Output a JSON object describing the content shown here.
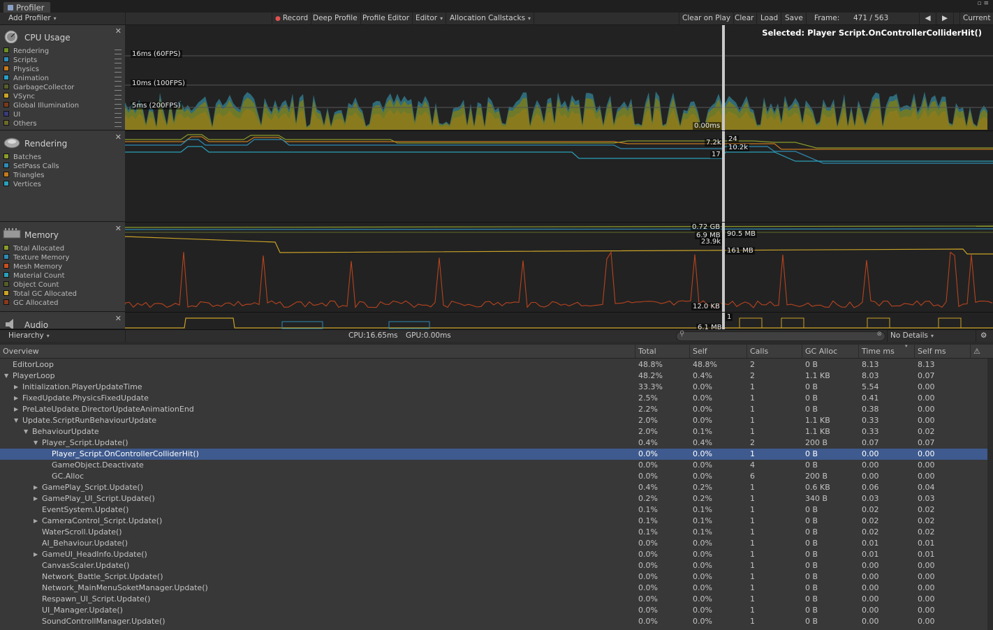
{
  "window": {
    "tab_title": "Profiler"
  },
  "toolbar": {
    "add_profiler": "Add Profiler",
    "record": "Record",
    "deep_profile": "Deep Profile",
    "profile_editor": "Profile Editor",
    "editor": "Editor",
    "allocation_callstacks": "Allocation Callstacks",
    "clear_on_play": "Clear on Play",
    "clear": "Clear",
    "load": "Load",
    "save": "Save",
    "frame_label": "Frame:",
    "frame_value": "471 / 563",
    "current": "Current"
  },
  "modules": {
    "cpu": {
      "title": "CPU Usage",
      "legend": [
        {
          "label": "Rendering",
          "color": "#6b8e23"
        },
        {
          "label": "Scripts",
          "color": "#2e8bb3"
        },
        {
          "label": "Physics",
          "color": "#c47a1e"
        },
        {
          "label": "Animation",
          "color": "#2a9fc4"
        },
        {
          "label": "GarbageCollector",
          "color": "#555d2a"
        },
        {
          "label": "VSync",
          "color": "#c9a227"
        },
        {
          "label": "Global Illumination",
          "color": "#7a3a1a"
        },
        {
          "label": "UI",
          "color": "#3a3a7a"
        },
        {
          "label": "Others",
          "color": "#6b6b2a"
        }
      ],
      "labels": {
        "fps60": "16ms (60FPS)",
        "fps100": "10ms (100FPS)",
        "fps200": "5ms (200FPS)",
        "zero": "0.00ms"
      },
      "selected": "Selected: Player  Script.OnControllerColliderHit()"
    },
    "rendering": {
      "title": "Rendering",
      "legend": [
        {
          "label": "Batches",
          "color": "#8a9a2a"
        },
        {
          "label": "SetPass Calls",
          "color": "#2e8bb3"
        },
        {
          "label": "Triangles",
          "color": "#c47a1e"
        },
        {
          "label": "Vertices",
          "color": "#2aa0b8"
        }
      ],
      "labels": {
        "a": "7.2k",
        "b": "24",
        "c": "10.2k",
        "d": "17"
      }
    },
    "memory": {
      "title": "Memory",
      "legend": [
        {
          "label": "Total Allocated",
          "color": "#8a9a2a"
        },
        {
          "label": "Texture Memory",
          "color": "#2e8bb3"
        },
        {
          "label": "Mesh Memory",
          "color": "#c4501e"
        },
        {
          "label": "Material Count",
          "color": "#2aa0b8"
        },
        {
          "label": "Object Count",
          "color": "#555d2a"
        },
        {
          "label": "Total GC Allocated",
          "color": "#c9a227"
        },
        {
          "label": "GC Allocated",
          "color": "#8a3a1a"
        }
      ],
      "labels": {
        "a": "0.72 GB",
        "b": "6.9 MB",
        "c": "23.9k",
        "d": "90.5 MB",
        "e": "161  MB",
        "f": "12.0 KB"
      }
    },
    "audio": {
      "title": "Audio",
      "labels": {
        "a": "1",
        "b": "6.1 MB"
      }
    }
  },
  "hierarchy_bar": {
    "view": "Hierarchy",
    "cpu": "CPU:16.65ms",
    "gpu": "GPU:0.00ms",
    "details": "No Details"
  },
  "table": {
    "columns": [
      "Overview",
      "Total",
      "Self",
      "Calls",
      "GC Alloc",
      "Time ms",
      "Self ms"
    ],
    "rows": [
      {
        "name": "EditorLoop",
        "indent": 0,
        "tri": "",
        "total": "48.8%",
        "self": "48.8%",
        "calls": "2",
        "gc": "0 B",
        "time": "8.13",
        "selfms": "8.13"
      },
      {
        "name": "PlayerLoop",
        "indent": 0,
        "tri": "▼",
        "total": "48.2%",
        "self": "0.4%",
        "calls": "2",
        "gc": "1.1 KB",
        "time": "8.03",
        "selfms": "0.07"
      },
      {
        "name": "Initialization.PlayerUpdateTime",
        "indent": 1,
        "tri": "▶",
        "total": "33.3%",
        "self": "0.0%",
        "calls": "1",
        "gc": "0 B",
        "time": "5.54",
        "selfms": "0.00"
      },
      {
        "name": "FixedUpdate.PhysicsFixedUpdate",
        "indent": 1,
        "tri": "▶",
        "total": "2.5%",
        "self": "0.0%",
        "calls": "1",
        "gc": "0 B",
        "time": "0.41",
        "selfms": "0.00"
      },
      {
        "name": "PreLateUpdate.DirectorUpdateAnimationEnd",
        "indent": 1,
        "tri": "▶",
        "total": "2.2%",
        "self": "0.0%",
        "calls": "1",
        "gc": "0 B",
        "time": "0.38",
        "selfms": "0.00"
      },
      {
        "name": "Update.ScriptRunBehaviourUpdate",
        "indent": 1,
        "tri": "▼",
        "total": "2.0%",
        "self": "0.0%",
        "calls": "1",
        "gc": "1.1 KB",
        "time": "0.33",
        "selfms": "0.00"
      },
      {
        "name": "BehaviourUpdate",
        "indent": 2,
        "tri": "▼",
        "total": "2.0%",
        "self": "0.1%",
        "calls": "1",
        "gc": "1.1 KB",
        "time": "0.33",
        "selfms": "0.02"
      },
      {
        "name": "Player_Script.Update()",
        "indent": 3,
        "tri": "▼",
        "total": "0.4%",
        "self": "0.4%",
        "calls": "2",
        "gc": "200 B",
        "time": "0.07",
        "selfms": "0.07"
      },
      {
        "name": "Player_Script.OnControllerColliderHit()",
        "indent": 4,
        "tri": "",
        "total": "0.0%",
        "self": "0.0%",
        "calls": "1",
        "gc": "0 B",
        "time": "0.00",
        "selfms": "0.00",
        "selected": true
      },
      {
        "name": "GameObject.Deactivate",
        "indent": 4,
        "tri": "",
        "total": "0.0%",
        "self": "0.0%",
        "calls": "4",
        "gc": "0 B",
        "time": "0.00",
        "selfms": "0.00"
      },
      {
        "name": "GC.Alloc",
        "indent": 4,
        "tri": "",
        "total": "0.0%",
        "self": "0.0%",
        "calls": "6",
        "gc": "200 B",
        "time": "0.00",
        "selfms": "0.00"
      },
      {
        "name": "GamePlay_Script.Update()",
        "indent": 3,
        "tri": "▶",
        "total": "0.4%",
        "self": "0.2%",
        "calls": "1",
        "gc": "0.6 KB",
        "time": "0.06",
        "selfms": "0.04"
      },
      {
        "name": "GamePlay_UI_Script.Update()",
        "indent": 3,
        "tri": "▶",
        "total": "0.2%",
        "self": "0.2%",
        "calls": "1",
        "gc": "340 B",
        "time": "0.03",
        "selfms": "0.03"
      },
      {
        "name": "EventSystem.Update()",
        "indent": 3,
        "tri": "",
        "total": "0.1%",
        "self": "0.1%",
        "calls": "1",
        "gc": "0 B",
        "time": "0.02",
        "selfms": "0.02"
      },
      {
        "name": "CameraControl_Script.Update()",
        "indent": 3,
        "tri": "▶",
        "total": "0.1%",
        "self": "0.1%",
        "calls": "1",
        "gc": "0 B",
        "time": "0.02",
        "selfms": "0.02"
      },
      {
        "name": "WaterScroll.Update()",
        "indent": 3,
        "tri": "",
        "total": "0.1%",
        "self": "0.1%",
        "calls": "1",
        "gc": "0 B",
        "time": "0.02",
        "selfms": "0.02"
      },
      {
        "name": "AI_Behaviour.Update()",
        "indent": 3,
        "tri": "",
        "total": "0.0%",
        "self": "0.0%",
        "calls": "1",
        "gc": "0 B",
        "time": "0.01",
        "selfms": "0.01"
      },
      {
        "name": "GameUI_HeadInfo.Update()",
        "indent": 3,
        "tri": "▶",
        "total": "0.0%",
        "self": "0.0%",
        "calls": "1",
        "gc": "0 B",
        "time": "0.01",
        "selfms": "0.01"
      },
      {
        "name": "CanvasScaler.Update()",
        "indent": 3,
        "tri": "",
        "total": "0.0%",
        "self": "0.0%",
        "calls": "1",
        "gc": "0 B",
        "time": "0.00",
        "selfms": "0.00"
      },
      {
        "name": "Network_Battle_Script.Update()",
        "indent": 3,
        "tri": "",
        "total": "0.0%",
        "self": "0.0%",
        "calls": "1",
        "gc": "0 B",
        "time": "0.00",
        "selfms": "0.00"
      },
      {
        "name": "Network_MainMenuSoketManager.Update()",
        "indent": 3,
        "tri": "",
        "total": "0.0%",
        "self": "0.0%",
        "calls": "1",
        "gc": "0 B",
        "time": "0.00",
        "selfms": "0.00"
      },
      {
        "name": "Respawn_UI_Script.Update()",
        "indent": 3,
        "tri": "",
        "total": "0.0%",
        "self": "0.0%",
        "calls": "1",
        "gc": "0 B",
        "time": "0.00",
        "selfms": "0.00"
      },
      {
        "name": "UI_Manager.Update()",
        "indent": 3,
        "tri": "",
        "total": "0.0%",
        "self": "0.0%",
        "calls": "1",
        "gc": "0 B",
        "time": "0.00",
        "selfms": "0.00"
      },
      {
        "name": "SoundControllManager.Update()",
        "indent": 3,
        "tri": "",
        "total": "0.0%",
        "self": "0.0%",
        "calls": "1",
        "gc": "0 B",
        "time": "0.00",
        "selfms": "0.00"
      }
    ]
  }
}
